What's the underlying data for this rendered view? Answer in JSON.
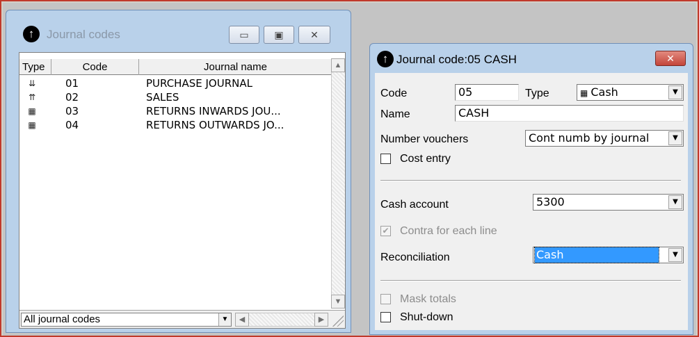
{
  "journal_list": {
    "title": "Journal codes",
    "columns": [
      "Type",
      "Code",
      "Journal name"
    ],
    "rows": [
      {
        "icon": "import-journal-icon",
        "code": "01",
        "name": "PURCHASE JOURNAL"
      },
      {
        "icon": "export-journal-icon",
        "code": "02",
        "name": "SALES"
      },
      {
        "icon": "general-journal-icon",
        "code": "03",
        "name": "RETURNS INWARDS JOU..."
      },
      {
        "icon": "general-journal-icon",
        "code": "04",
        "name": "RETURNS OUTWARDS JO..."
      }
    ],
    "filter": "All journal codes"
  },
  "journal_detail": {
    "title": "Journal code:05 CASH",
    "code_label": "Code",
    "code_value": "05",
    "type_label": "Type",
    "type_value": "Cash",
    "name_label": "Name",
    "name_value": "CASH",
    "number_vouchers_label": "Number vouchers",
    "number_vouchers_value": "Cont numb by journal",
    "cost_entry_label": "Cost entry",
    "cost_entry_checked": false,
    "cash_account_label": "Cash account",
    "cash_account_value": "5300",
    "contra_label": "Contra for each line",
    "contra_checked": true,
    "reconciliation_label": "Reconciliation",
    "reconciliation_value": "Cash",
    "mask_totals_label": "Mask totals",
    "mask_totals_checked": false,
    "shutdown_label": "Shut-down",
    "shutdown_checked": false
  },
  "colors": {
    "title_inactive": "#8a98a8",
    "close_button": "#c3453a",
    "selection": "#3399ff",
    "window_frame": "#b9d1ea"
  }
}
